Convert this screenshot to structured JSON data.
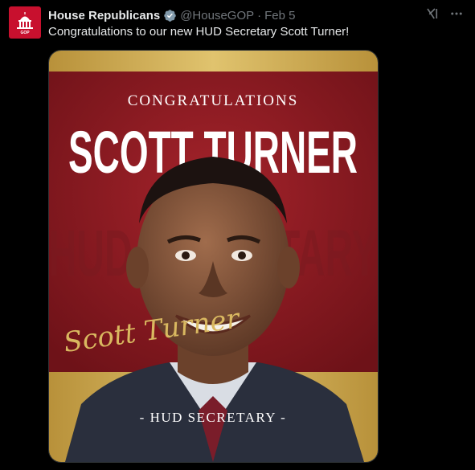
{
  "tweet": {
    "author_name": "House Republicans",
    "handle": "@HouseGOP",
    "separator": "·",
    "date": "Feb 5",
    "text": "Congratulations to our new HUD Secretary Scott Turner!"
  },
  "media": {
    "eyebrow": "CONGRATULATIONS",
    "headline": "SCOTT TURNER",
    "background_text": "HUD SECRETARY",
    "signature": "Scott Turner",
    "caption": "- HUD SECRETARY -",
    "colors": {
      "red": "#8e1b22",
      "gold": "#c9a64a",
      "white": "#ffffff"
    }
  },
  "icons": {
    "verified": "verified-badge-icon",
    "grok": "grok-icon",
    "more": "more-icon",
    "avatar": "capitol-logo-icon"
  }
}
